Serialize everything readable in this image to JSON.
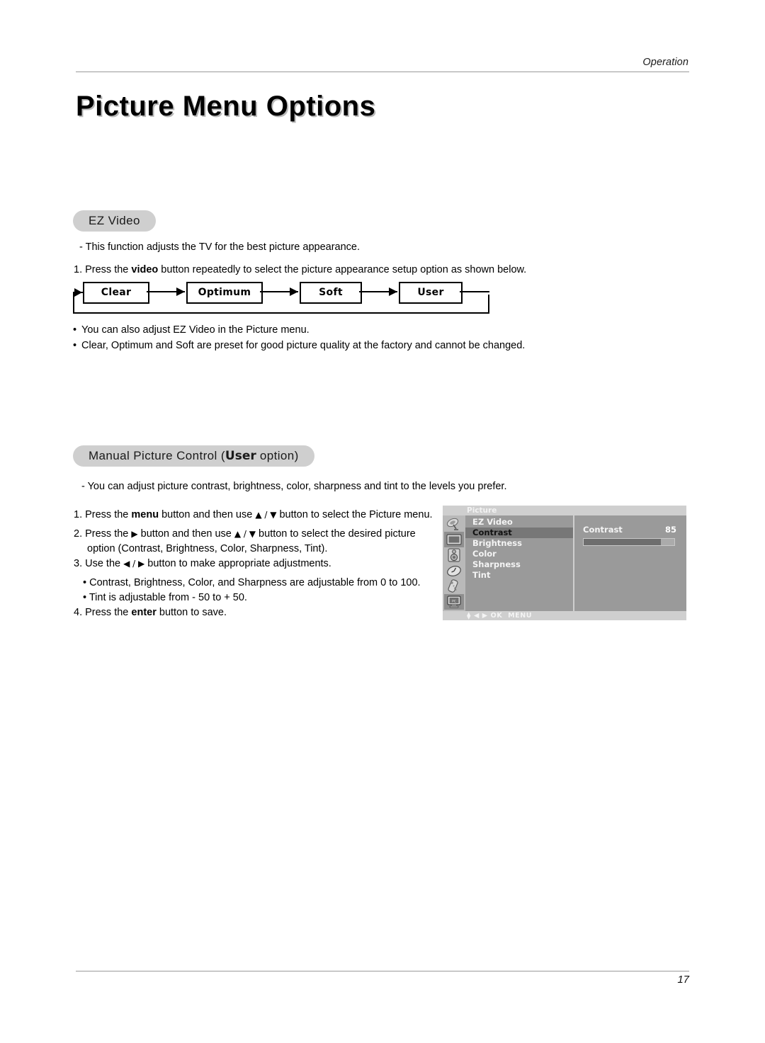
{
  "header": {
    "section_label": "Operation"
  },
  "page_title": "Picture Menu Options",
  "ez_video": {
    "heading": "EZ Video",
    "description": "-  This function adjusts the TV for the best picture appearance.",
    "step1_pre": "1. Press the ",
    "step1_bold": "video",
    "step1_post": " button repeatedly to select the picture appearance setup option as shown below.",
    "flow": {
      "items": [
        "Clear",
        "Optimum",
        "Soft",
        "User"
      ]
    },
    "bullets": [
      {
        "segments": [
          {
            "text": "You can also adjust ",
            "style": "normal"
          },
          {
            "text": "EZ Video",
            "style": "heavy"
          },
          {
            "text": " in the ",
            "style": "normal"
          },
          {
            "text": "Picture",
            "style": "heavy"
          },
          {
            "text": " menu.",
            "style": "normal"
          }
        ]
      },
      {
        "segments": [
          {
            "text": "Clear",
            "style": "heavy"
          },
          {
            "text": ", ",
            "style": "normal"
          },
          {
            "text": "Optimum",
            "style": "heavy"
          },
          {
            "text": " and ",
            "style": "normal"
          },
          {
            "text": "Soft",
            "style": "heavy"
          },
          {
            "text": " are preset for good picture quality at the factory and cannot be changed.",
            "style": "normal"
          }
        ]
      }
    ]
  },
  "manual_picture_control": {
    "heading_pre": "Manual Picture Control (",
    "heading_bold": "User",
    "heading_post": " option)",
    "description": "-  You can adjust picture contrast, brightness, color, sharpness and tint to the levels you prefer.",
    "step1": {
      "pre": "1.  Press the ",
      "bold1": "menu",
      "mid1": " button and then use ",
      "arrows": "▲ / ▼",
      "mid2": " button to select the ",
      "bold2": "Picture",
      "post": " menu."
    },
    "step2": {
      "pre": "2.  Press the ",
      "arrow_right": "▶",
      "mid1": " button and then use ",
      "arrows": "▲ / ▼",
      "mid2": " button to select the desired picture",
      "line2_pre": "option (",
      "options": [
        "Contrast",
        "Brightness",
        "Color",
        "Sharpness",
        "Tint"
      ],
      "line2_post": ")."
    },
    "step3": {
      "pre": "3.  Use the ",
      "arrows": "◀ / ▶",
      "post": " button to make appropriate adjustments."
    },
    "sub_bullets": [
      "• Contrast, Brightness, Color, and Sharpness are adjustable from 0 to 100.",
      "• Tint is adjustable from - 50 to + 50."
    ],
    "step4": {
      "pre": "4.  Press the ",
      "bold": "enter",
      "post": " button to save."
    }
  },
  "osd": {
    "title": "Picture",
    "icons": [
      {
        "name": "satellite-dish-icon",
        "selected": false
      },
      {
        "name": "tv-screen-icon",
        "selected": true
      },
      {
        "name": "speaker-icon",
        "selected": false
      },
      {
        "name": "clock-timer-icon",
        "selected": false
      },
      {
        "name": "remote-control-icon",
        "selected": false
      },
      {
        "name": "pc-monitor-icon",
        "selected": false
      }
    ],
    "menu_items": [
      {
        "label": "EZ Video",
        "selected": false
      },
      {
        "label": "Contrast",
        "selected": true
      },
      {
        "label": "Brightness",
        "selected": false
      },
      {
        "label": "Color",
        "selected": false
      },
      {
        "label": "Sharpness",
        "selected": false
      },
      {
        "label": "Tint",
        "selected": false
      }
    ],
    "detail": {
      "label": "Contrast",
      "value": "85",
      "fill_percent": 85
    },
    "footer": {
      "updown": "▲▼",
      "leftright": "◀ ▶",
      "ok": "OK",
      "menu": "MENU"
    },
    "colors": {
      "chrome": "#cfcfcf",
      "pane": "#9a9a9a",
      "iconbar": "#b9b9b9",
      "selected_row": "#777777",
      "slider_fill": "#6e6e6e"
    }
  },
  "footer": {
    "page_number": "17"
  }
}
